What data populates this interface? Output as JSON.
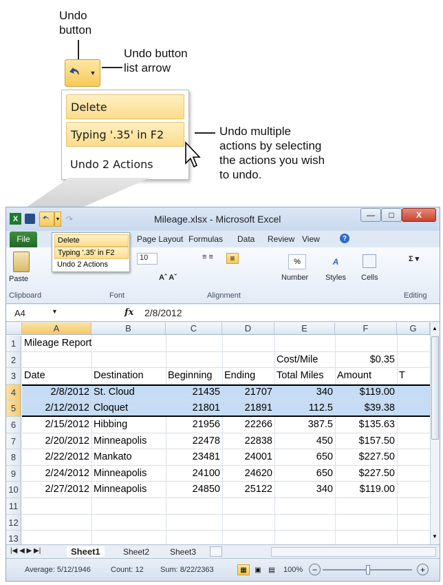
{
  "callouts": {
    "undo_button": "Undo\nbutton",
    "list_arrow": "Undo button\nlist arrow",
    "multiple": "Undo multiple\nactions by selecting\nthe actions you wish\nto undo."
  },
  "undo_menu": {
    "items": [
      "Delete",
      "Typing '.35' in F2",
      "Undo 2 Actions"
    ]
  },
  "window": {
    "title": "Mileage.xlsx - Microsoft Excel",
    "tabs": [
      "File",
      "Page Layout",
      "Formulas",
      "Data",
      "Review",
      "View"
    ]
  },
  "ribbon": {
    "paste_label": "Paste",
    "font_size": "10",
    "number_label": "Number",
    "styles_label": "Styles",
    "cells_label": "Cells",
    "groups": [
      "Clipboard",
      "Font",
      "Alignment",
      "Editing"
    ]
  },
  "formula_bar": {
    "name_box": "A4",
    "fx": "fx",
    "value": "2/8/2012"
  },
  "sheet": {
    "columns": [
      "A",
      "B",
      "C",
      "D",
      "E",
      "F",
      "G"
    ],
    "row_numbers": [
      "1",
      "2",
      "3",
      "4",
      "5",
      "6",
      "7",
      "8",
      "9",
      "10",
      "11",
      "12",
      "13"
    ],
    "rows": [
      [
        "Mileage Report",
        "",
        "",
        "",
        "",
        "",
        ""
      ],
      [
        "",
        "",
        "",
        "",
        "Cost/Mile",
        "$0.35",
        ""
      ],
      [
        "Date",
        "Destination",
        "Beginning",
        "Ending",
        "Total Miles",
        "Amount",
        "T"
      ],
      [
        "2/8/2012",
        "St. Cloud",
        "21435",
        "21707",
        "340",
        "$119.00",
        ""
      ],
      [
        "2/12/2012",
        "Cloquet",
        "21801",
        "21891",
        "112.5",
        "$39.38",
        ""
      ],
      [
        "2/15/2012",
        "Hibbing",
        "21956",
        "22266",
        "387.5",
        "$135.63",
        ""
      ],
      [
        "2/20/2012",
        "Minneapolis",
        "22478",
        "22838",
        "450",
        "$157.50",
        ""
      ],
      [
        "2/22/2012",
        "Mankato",
        "23481",
        "24001",
        "650",
        "$227.50",
        ""
      ],
      [
        "2/24/2012",
        "Minneapolis",
        "24100",
        "24620",
        "650",
        "$227.50",
        ""
      ],
      [
        "2/27/2012",
        "Minneapolis",
        "24850",
        "25122",
        "340",
        "$119.00",
        ""
      ],
      [
        "",
        "",
        "",
        "",
        "",
        "",
        ""
      ],
      [
        "",
        "",
        "",
        "",
        "",
        "",
        ""
      ],
      [
        "",
        "",
        "",
        "",
        "",
        "",
        ""
      ]
    ]
  },
  "sheet_tabs": [
    "Sheet1",
    "Sheet2",
    "Sheet3"
  ],
  "status": {
    "average": "Average: 5/12/1946",
    "count": "Count: 12",
    "sum": "Sum: 8/22/2363",
    "zoom": "100%"
  }
}
